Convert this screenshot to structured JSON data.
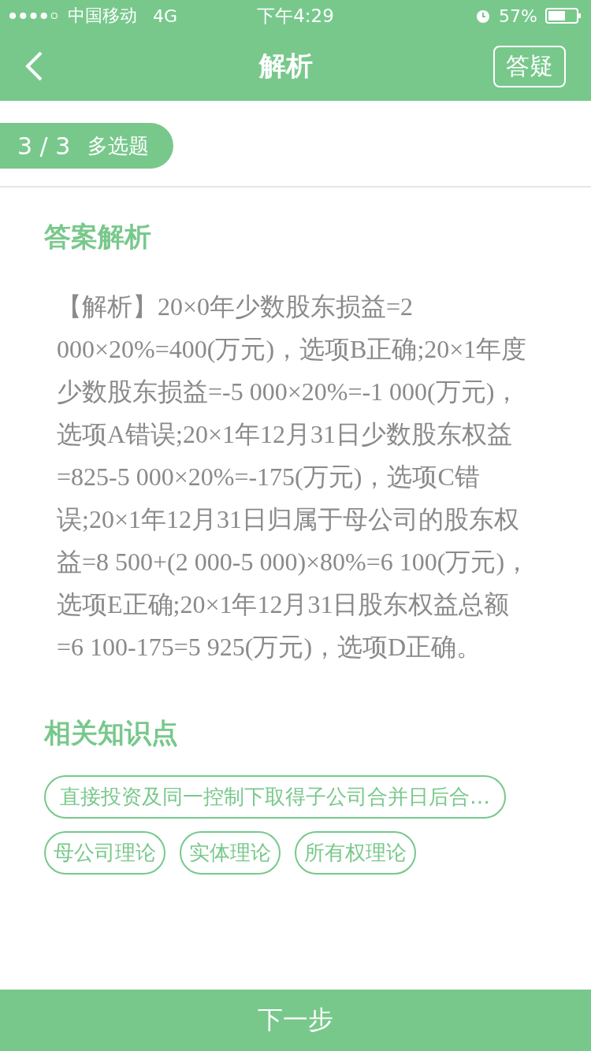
{
  "status_bar": {
    "carrier": "中国移动",
    "network": "4G",
    "time": "下午4:29",
    "battery": "57%"
  },
  "nav": {
    "title": "解析",
    "action": "答疑"
  },
  "question_badge": {
    "progress": "3 / 3",
    "type": "多选题"
  },
  "analysis": {
    "heading": "答案解析",
    "text": "【解析】20×0年少数股东损益=2 000×20%=400(万元)，选项B正确;20×1年度少数股东损益=-5 000×20%=-1 000(万元)，选项A错误;20×1年12月31日少数股东权益=825-5 000×20%=-175(万元)，选项C错误;20×1年12月31日归属于母公司的股东权益=8 500+(2 000-5 000)×80%=6 100(万元)，选项E正确;20×1年12月31日股东权益总额=6 100-175=5 925(万元)，选项D正确。"
  },
  "knowledge": {
    "heading": "相关知识点",
    "tags": [
      "直接投资及同一控制下取得子公司合并日后合…",
      "母公司理论",
      "实体理论",
      "所有权理论"
    ]
  },
  "next_button": "下一步"
}
